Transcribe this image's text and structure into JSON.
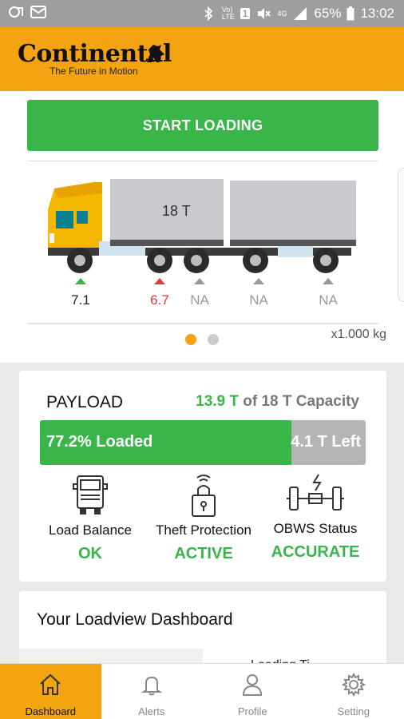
{
  "statusbar": {
    "battery": "65%",
    "time": "13:02",
    "volte": "Vo)\nLTE",
    "sim": "1",
    "network": "4G"
  },
  "header": {
    "brand": "Continental",
    "tagline": "The Future in Motion"
  },
  "start_button": {
    "label": "START LOADING"
  },
  "truck": {
    "container_label": "18 T",
    "axles": [
      {
        "value": "7.1",
        "status": "up",
        "color": "#39b54a"
      },
      {
        "value": "6.7",
        "status": "up",
        "color": "#e53935"
      },
      {
        "value": "NA",
        "status": "na",
        "color": "#999999"
      },
      {
        "value": "NA",
        "status": "na",
        "color": "#999999"
      },
      {
        "value": "NA",
        "status": "na",
        "color": "#999999"
      }
    ],
    "unit": "x1.000 kg"
  },
  "payload": {
    "title": "PAYLOAD",
    "loaded_amount": "13.9 T",
    "capacity_text": " of 18 T Capacity",
    "loaded_percent": 77.2,
    "loaded_label": "77.2% Loaded",
    "left_label": "4.1 T Left"
  },
  "status_items": [
    {
      "label": "Load Balance",
      "value": "OK",
      "icon": "truck-front-icon"
    },
    {
      "label": "Theft Protection",
      "value": "ACTIVE",
      "icon": "lock-icon"
    },
    {
      "label": "OBWS Status",
      "value": "ACCURATE",
      "icon": "axle-sensor-icon"
    }
  ],
  "dashboard": {
    "title": "Your Loadview Dashboard",
    "sub": "Loading Ti"
  },
  "nav": [
    {
      "label": "Dashboard",
      "icon": "home-icon",
      "active": true
    },
    {
      "label": "Alerts",
      "icon": "bell-icon",
      "active": false
    },
    {
      "label": "Profile",
      "icon": "user-icon",
      "active": false
    },
    {
      "label": "Setting",
      "icon": "gear-icon",
      "active": false
    }
  ],
  "colors": {
    "accent": "#f4a311",
    "green": "#39b54a",
    "red": "#e53935"
  }
}
